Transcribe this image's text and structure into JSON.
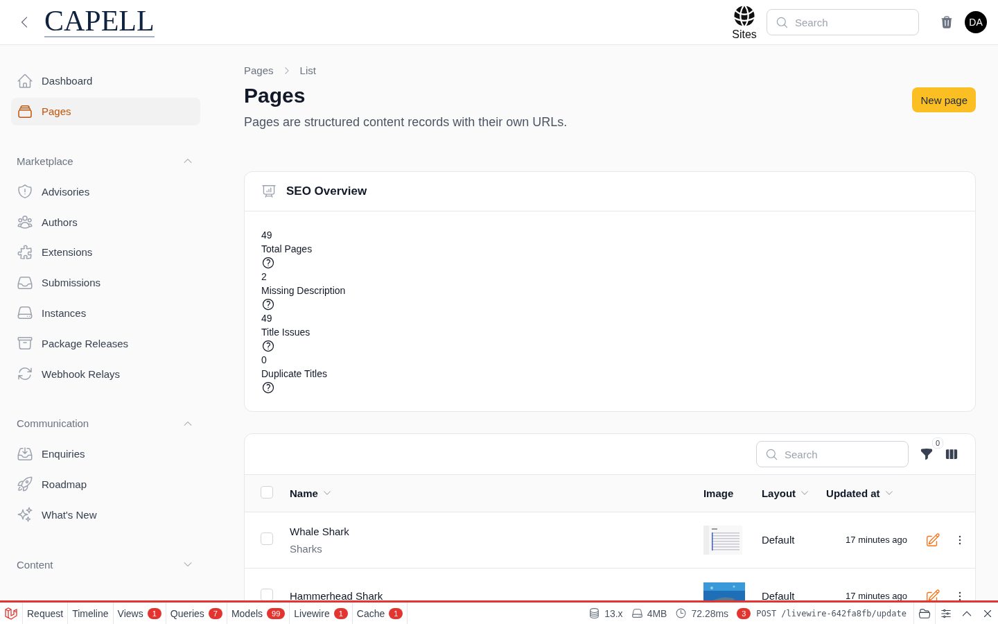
{
  "header": {
    "logo": "CAPELL",
    "sites_label": "Sites",
    "search": {
      "placeholder": "Search"
    },
    "avatar": "DA"
  },
  "sidebar": {
    "items": [
      {
        "label": "Dashboard",
        "selected": false
      },
      {
        "label": "Pages",
        "selected": true
      }
    ],
    "groups": [
      {
        "label": "Marketplace",
        "expanded": true,
        "items": [
          {
            "label": "Advisories",
            "selected": false
          },
          {
            "label": "Authors",
            "selected": false
          },
          {
            "label": "Extensions",
            "selected": false
          },
          {
            "label": "Submissions",
            "selected": false
          },
          {
            "label": "Instances",
            "selected": false
          },
          {
            "label": "Package Releases",
            "selected": false
          },
          {
            "label": "Webhook Relays",
            "selected": false
          }
        ]
      },
      {
        "label": "Communication",
        "expanded": true,
        "items": [
          {
            "label": "Enquiries",
            "selected": false
          },
          {
            "label": "Roadmap",
            "selected": false
          },
          {
            "label": "What's New",
            "selected": false
          }
        ]
      },
      {
        "label": "Content",
        "expanded": false
      }
    ]
  },
  "breadcrumbs": [
    "Pages",
    "List"
  ],
  "page": {
    "title": "Pages",
    "description": "Pages are structured content records with their own URLs.",
    "action": "New page"
  },
  "seo_overview": {
    "title": "SEO Overview",
    "stats": [
      {
        "value": "49",
        "label": "Total Pages"
      },
      {
        "value": "2",
        "label": "Missing Description"
      },
      {
        "value": "49",
        "label": "Title Issues"
      },
      {
        "value": "0",
        "label": "Duplicate Titles"
      }
    ]
  },
  "table": {
    "search": {
      "placeholder": "Search"
    },
    "filter_count": "0",
    "all_checked": false,
    "columns": [
      {
        "label": "Name",
        "sortable": true
      },
      {
        "label": "Image",
        "sortable": false
      },
      {
        "label": "Layout",
        "sortable": true
      },
      {
        "label": "Updated at",
        "sortable": true
      }
    ],
    "rows": [
      {
        "name": "Whale Shark",
        "category": "Sharks",
        "layout": "Default",
        "updated": "17 minutes ago",
        "checked": false
      },
      {
        "name": "Hammerhead Shark",
        "layout": "Default",
        "updated": "17 minutes ago",
        "checked": false
      }
    ]
  },
  "debug_bar": {
    "tabs": [
      {
        "label": "Request"
      },
      {
        "label": "Timeline"
      },
      {
        "label": "Views",
        "count": "1"
      },
      {
        "label": "Queries",
        "count": "7"
      },
      {
        "label": "Models",
        "count": "99"
      },
      {
        "label": "Livewire",
        "count": "1"
      },
      {
        "label": "Cache",
        "count": "1"
      }
    ],
    "version": "13.x",
    "memory": "4MB",
    "duration": "72.28ms",
    "request_count": "3",
    "request": "POST /livewire-642fa8fb/update"
  }
}
